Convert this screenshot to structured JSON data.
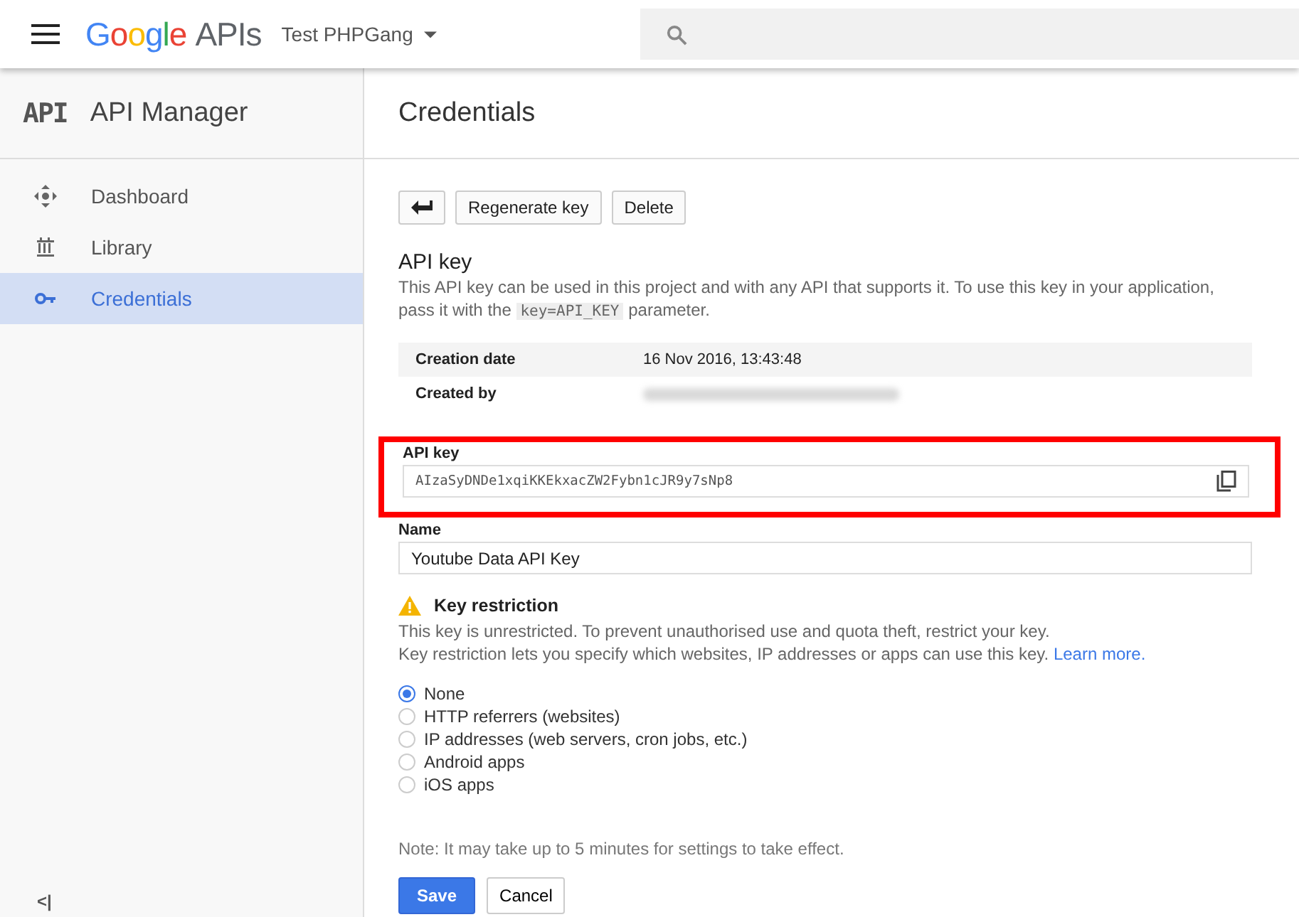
{
  "topbar": {
    "brand_google": "Google",
    "brand_apis": "APIs",
    "project": "Test PHPGang"
  },
  "sidebar": {
    "logo_text": "API",
    "title": "API Manager",
    "items": [
      {
        "label": "Dashboard",
        "selected": false
      },
      {
        "label": "Library",
        "selected": false
      },
      {
        "label": "Credentials",
        "selected": true
      }
    ],
    "collapse": "<|"
  },
  "page": {
    "title": "Credentials",
    "buttons": [
      "Regenerate key",
      "Delete"
    ],
    "section_title": "API key",
    "description_before": "This API key can be used in this project and with any API that supports it. To use this key in your application, pass it with the",
    "description_code": "key=API_KEY",
    "description_after": "parameter.",
    "details": [
      {
        "label": "Creation date",
        "value": "16 Nov 2016, 13:43:48",
        "redacted": false
      },
      {
        "label": "Created by",
        "redacted": true
      }
    ],
    "api_key_field": {
      "label": "API key",
      "value": "AIzaSyDNDe1xqiKKEkxacZW2Fybn1cJR9y7sNp8",
      "highlighted": true
    },
    "name_field": {
      "label": "Name",
      "value": "Youtube Data API Key"
    },
    "restriction": {
      "title": "Key restriction",
      "line1": "This key is unrestricted. To prevent unauthorised use and quota theft, restrict your key.",
      "line2": "Key restriction lets you specify which websites, IP addresses or apps can use this key.",
      "link": "Learn more."
    },
    "options": [
      {
        "label": "None",
        "selected": true
      },
      {
        "label": "HTTP referrers (websites)",
        "selected": false
      },
      {
        "label": "IP addresses (web servers, cron jobs, etc.)",
        "selected": false
      },
      {
        "label": "Android apps",
        "selected": false
      },
      {
        "label": "iOS apps",
        "selected": false
      }
    ],
    "note": "Note: It may take up to 5 minutes for settings to take effect.",
    "save": "Save",
    "cancel": "Cancel"
  }
}
